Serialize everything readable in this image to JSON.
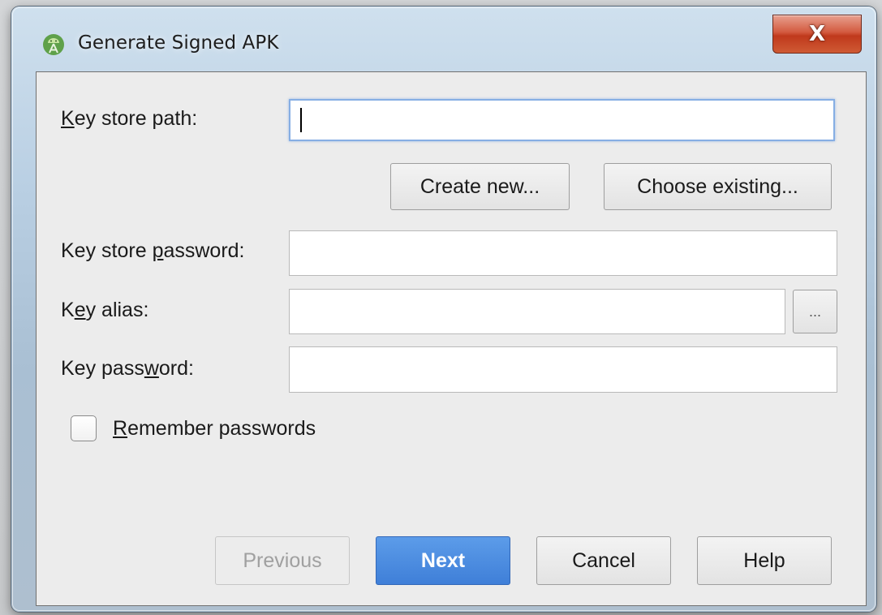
{
  "window": {
    "title": "Generate Signed APK",
    "app_icon": "android-studio-icon",
    "close_glyph": "X"
  },
  "form": {
    "key_store_path": {
      "label_pre": "",
      "label_mnemonic": "K",
      "label_post": "ey store path:",
      "value": "",
      "focused": true
    },
    "create_new_label": "Create new...",
    "choose_existing_label": "Choose existing...",
    "key_store_password": {
      "label_pre": "Key store ",
      "label_mnemonic": "p",
      "label_post": "assword:",
      "value": ""
    },
    "key_alias": {
      "label_pre": "K",
      "label_mnemonic": "e",
      "label_post": "y alias:",
      "value": "",
      "browse_label": "..."
    },
    "key_password": {
      "label_pre": "Key pass",
      "label_mnemonic": "w",
      "label_post": "ord:",
      "value": ""
    },
    "remember_passwords": {
      "label_mnemonic": "R",
      "label_post": "emember passwords",
      "checked": false
    }
  },
  "footer": {
    "previous_label": "Previous",
    "next_label": "Next",
    "cancel_label": "Cancel",
    "help_label": "Help"
  },
  "colors": {
    "primary_button": "#4a8ae0",
    "focus_ring": "#86aee4",
    "close_button": "#c8432a"
  }
}
